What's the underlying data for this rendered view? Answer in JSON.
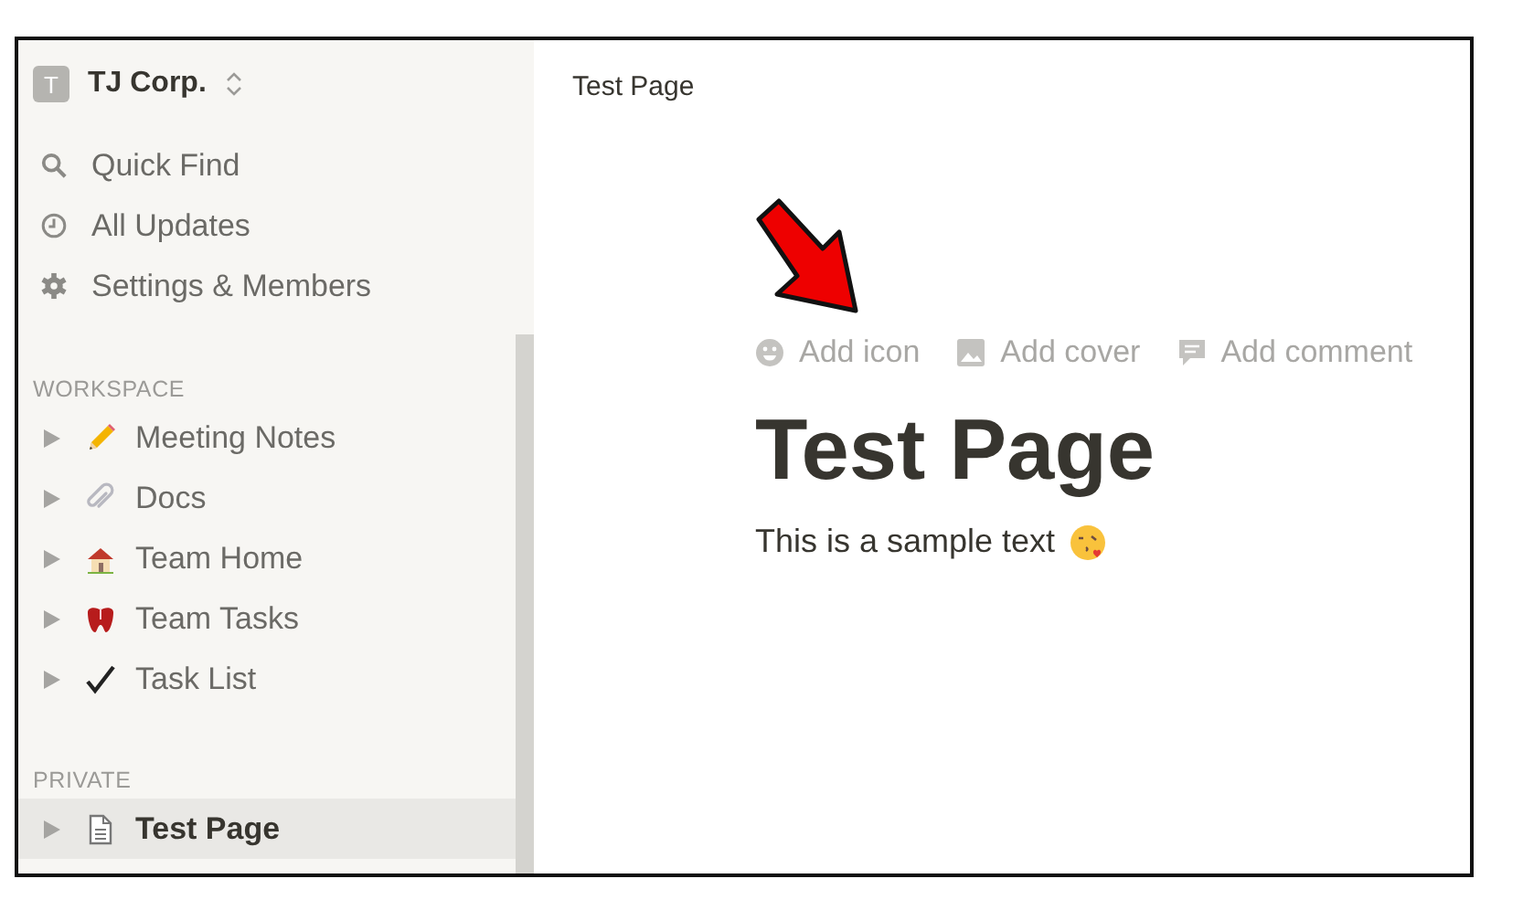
{
  "sidebar": {
    "workspace_switcher": {
      "badge": "T",
      "name": "TJ Corp."
    },
    "nav": [
      {
        "kind": "search",
        "label": "Quick Find"
      },
      {
        "kind": "clock",
        "label": "All Updates"
      },
      {
        "kind": "gear",
        "label": "Settings & Members"
      }
    ],
    "sections": [
      {
        "title": "WORKSPACE",
        "items": [
          {
            "kind": "pencil",
            "label": "Meeting Notes",
            "selected": false
          },
          {
            "kind": "paperclip",
            "label": "Docs",
            "selected": false
          },
          {
            "kind": "house",
            "label": "Team Home",
            "selected": false
          },
          {
            "kind": "tooth",
            "label": "Team Tasks",
            "selected": false
          },
          {
            "kind": "check",
            "label": "Task List",
            "selected": false
          }
        ]
      },
      {
        "title": "PRIVATE",
        "items": [
          {
            "kind": "page",
            "label": "Test Page",
            "selected": true
          }
        ]
      }
    ]
  },
  "page": {
    "breadcrumb": "Test Page",
    "actions": [
      {
        "kind": "smile",
        "label": "Add icon"
      },
      {
        "kind": "image",
        "label": "Add cover"
      },
      {
        "kind": "comment",
        "label": "Add comment"
      }
    ],
    "title": "Test Page",
    "body": {
      "text": "This is a sample text"
    }
  }
}
